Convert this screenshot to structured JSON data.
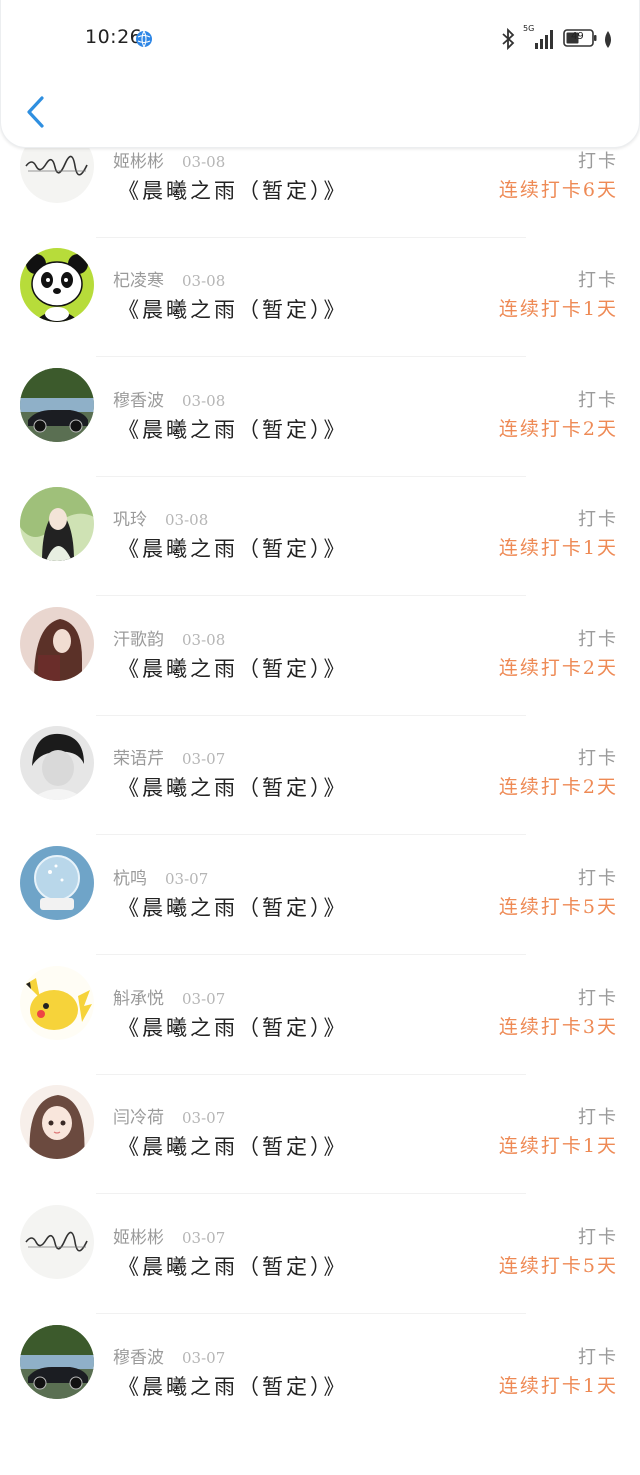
{
  "status_bar": {
    "time": "10:26",
    "network_label": "5G",
    "battery_level": "49"
  },
  "header": {
    "back_icon": "chevron-left-icon"
  },
  "checkins": [
    {
      "name": "姬彬彬",
      "date": "03-08",
      "book": "《晨曦之雨（暂定）》",
      "action": "打卡",
      "streak": "连续打卡6天",
      "avatar": "calligraphy"
    },
    {
      "name": "杞凌寒",
      "date": "03-08",
      "book": "《晨曦之雨（暂定）》",
      "action": "打卡",
      "streak": "连续打卡1天",
      "avatar": "panda"
    },
    {
      "name": "穆香波",
      "date": "03-08",
      "book": "《晨曦之雨（暂定）》",
      "action": "打卡",
      "streak": "连续打卡2天",
      "avatar": "car"
    },
    {
      "name": "巩玲",
      "date": "03-08",
      "book": "《晨曦之雨（暂定）》",
      "action": "打卡",
      "streak": "连续打卡1天",
      "avatar": "lady"
    },
    {
      "name": "汗歌韵",
      "date": "03-08",
      "book": "《晨曦之雨（暂定）》",
      "action": "打卡",
      "streak": "连续打卡2天",
      "avatar": "girl-photo"
    },
    {
      "name": "荣语芹",
      "date": "03-07",
      "book": "《晨曦之雨（暂定）》",
      "action": "打卡",
      "streak": "连续打卡2天",
      "avatar": "bw-boy"
    },
    {
      "name": "杭鸣",
      "date": "03-07",
      "book": "《晨曦之雨（暂定）》",
      "action": "打卡",
      "streak": "连续打卡5天",
      "avatar": "snow-globe"
    },
    {
      "name": "斛承悦",
      "date": "03-07",
      "book": "《晨曦之雨（暂定）》",
      "action": "打卡",
      "streak": "连续打卡3天",
      "avatar": "pikachu"
    },
    {
      "name": "闫冷荷",
      "date": "03-07",
      "book": "《晨曦之雨（暂定）》",
      "action": "打卡",
      "streak": "连续打卡1天",
      "avatar": "anime-girl"
    },
    {
      "name": "姬彬彬",
      "date": "03-07",
      "book": "《晨曦之雨（暂定）》",
      "action": "打卡",
      "streak": "连续打卡5天",
      "avatar": "calligraphy"
    },
    {
      "name": "穆香波",
      "date": "03-07",
      "book": "《晨曦之雨（暂定）》",
      "action": "打卡",
      "streak": "连续打卡1天",
      "avatar": "car"
    }
  ],
  "colors": {
    "accent_back": "#2f8fe0",
    "streak": "#ee8a55",
    "meta": "#9a9a9a",
    "title": "#222222"
  }
}
